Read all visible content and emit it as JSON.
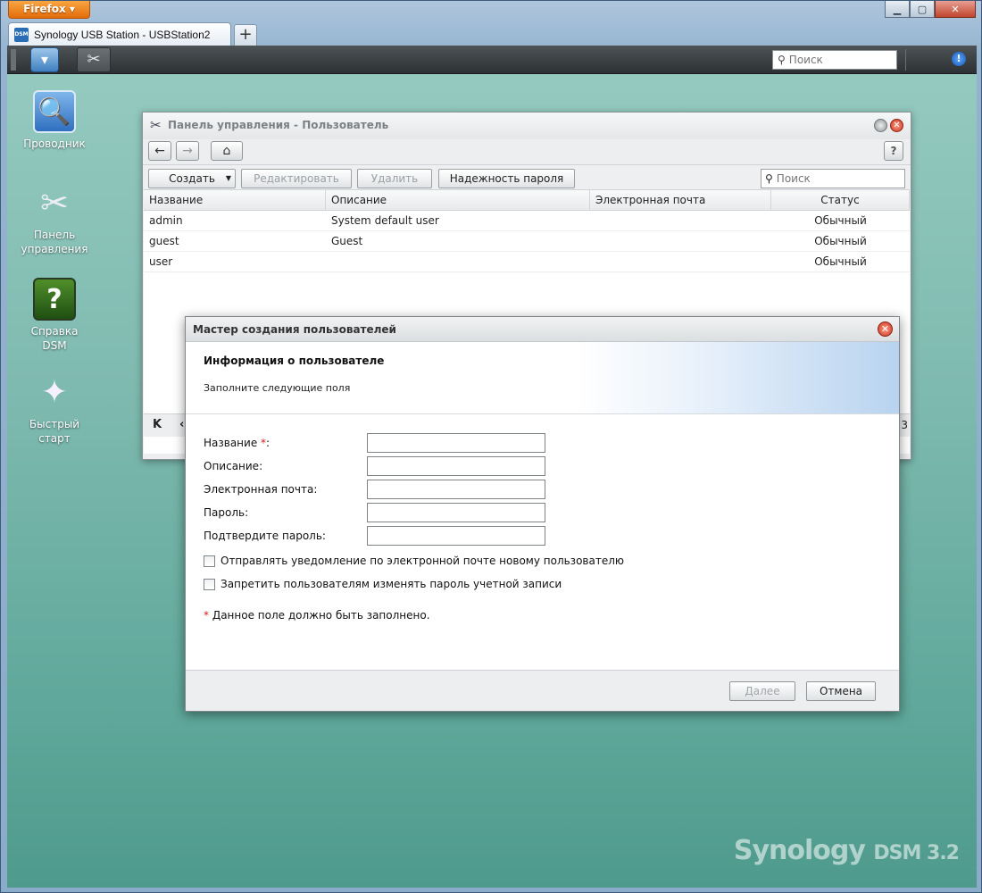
{
  "browser": {
    "menu_label": "Firefox",
    "tab_favicon_text": "DSM",
    "tab_title": "Synology USB Station - USBStation2",
    "new_tab_icon": "plus-icon",
    "window_controls": [
      "minimize-icon",
      "maximize-icon",
      "close-icon"
    ]
  },
  "taskbar": {
    "search_placeholder": "Поиск",
    "notification_icon": "info-icon"
  },
  "desktop": {
    "icons": [
      {
        "label": "Проводник",
        "icon": "file-explorer-icon"
      },
      {
        "label": "Панель управления",
        "icon": "control-panel-icon"
      },
      {
        "label": "Справка DSM",
        "icon": "help-book-icon"
      },
      {
        "label": "Быстрый старт",
        "icon": "magic-wand-icon"
      }
    ],
    "brand": "Synology",
    "brand_version": "DSM 3.2"
  },
  "control_panel": {
    "title": "Панель управления - Пользователь",
    "toolbar": {
      "create": "Создать",
      "edit": "Редактировать",
      "delete": "Удалить",
      "password_strength": "Надежность пароля",
      "search_placeholder": "Поиск"
    },
    "columns": [
      "Название",
      "Описание",
      "Электронная почта",
      "Статус"
    ],
    "rows": [
      {
        "name": "admin",
        "description": "System default user",
        "email": "",
        "status": "Обычный"
      },
      {
        "name": "guest",
        "description": "Guest",
        "email": "",
        "status": "Обычный"
      },
      {
        "name": "user",
        "description": "",
        "email": "",
        "status": "Обычный"
      }
    ],
    "pager_count": "3"
  },
  "wizard": {
    "title": "Мастер создания пользователей",
    "heading": "Информация о пользователе",
    "subheading": "Заполните следующие поля",
    "fields": {
      "name": {
        "label": "Название ",
        "required_mark": "*",
        "suffix": ":",
        "value": ""
      },
      "description": {
        "label": "Описание:",
        "value": ""
      },
      "email": {
        "label": "Электронная почта:",
        "value": ""
      },
      "password": {
        "label": "Пароль:",
        "value": ""
      },
      "confirm_password": {
        "label": "Подтвердите пароль:",
        "value": ""
      }
    },
    "checkboxes": {
      "notify_email": {
        "label": "Отправлять уведомление по электронной почте новому пользователю",
        "checked": false
      },
      "deny_password_change": {
        "label": "Запретить пользователям изменять пароль учетной записи",
        "checked": false
      }
    },
    "required_note": {
      "mark": "*",
      "text": " Данное поле должно быть заполнено."
    },
    "buttons": {
      "next": "Далее",
      "cancel": "Отмена"
    }
  }
}
